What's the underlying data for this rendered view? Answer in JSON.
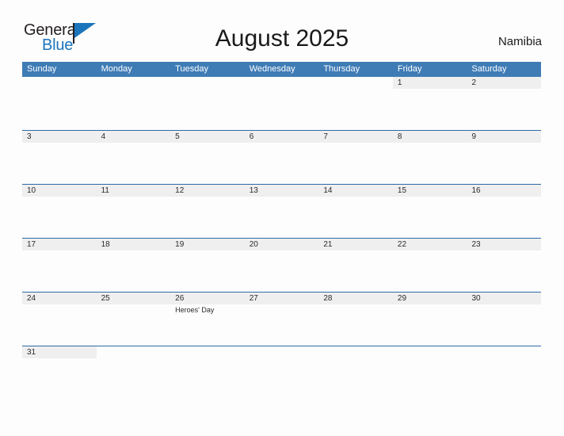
{
  "brand": {
    "name_part1": "General",
    "name_part2": "Blue",
    "flag_icon": "blue-flag-triangle"
  },
  "header": {
    "title": "August 2025",
    "country": "Namibia"
  },
  "calendar": {
    "weekday_headers": [
      "Sunday",
      "Monday",
      "Tuesday",
      "Wednesday",
      "Thursday",
      "Friday",
      "Saturday"
    ],
    "colors": {
      "header_blue": "#3f7cb6",
      "row_rule_blue": "#2c6ba5",
      "date_band_gray": "#efefef",
      "page_background": "#fdfdfd",
      "brand_blue": "#1b75bc",
      "text_dark": "#231f20"
    },
    "weeks": [
      [
        {
          "day": "",
          "event": ""
        },
        {
          "day": "",
          "event": ""
        },
        {
          "day": "",
          "event": ""
        },
        {
          "day": "",
          "event": ""
        },
        {
          "day": "",
          "event": ""
        },
        {
          "day": "1",
          "event": ""
        },
        {
          "day": "2",
          "event": ""
        }
      ],
      [
        {
          "day": "3",
          "event": ""
        },
        {
          "day": "4",
          "event": ""
        },
        {
          "day": "5",
          "event": ""
        },
        {
          "day": "6",
          "event": ""
        },
        {
          "day": "7",
          "event": ""
        },
        {
          "day": "8",
          "event": ""
        },
        {
          "day": "9",
          "event": ""
        }
      ],
      [
        {
          "day": "10",
          "event": ""
        },
        {
          "day": "11",
          "event": ""
        },
        {
          "day": "12",
          "event": ""
        },
        {
          "day": "13",
          "event": ""
        },
        {
          "day": "14",
          "event": ""
        },
        {
          "day": "15",
          "event": ""
        },
        {
          "day": "16",
          "event": ""
        }
      ],
      [
        {
          "day": "17",
          "event": ""
        },
        {
          "day": "18",
          "event": ""
        },
        {
          "day": "19",
          "event": ""
        },
        {
          "day": "20",
          "event": ""
        },
        {
          "day": "21",
          "event": ""
        },
        {
          "day": "22",
          "event": ""
        },
        {
          "day": "23",
          "event": ""
        }
      ],
      [
        {
          "day": "24",
          "event": ""
        },
        {
          "day": "25",
          "event": ""
        },
        {
          "day": "26",
          "event": "Heroes' Day"
        },
        {
          "day": "27",
          "event": ""
        },
        {
          "day": "28",
          "event": ""
        },
        {
          "day": "29",
          "event": ""
        },
        {
          "day": "30",
          "event": ""
        }
      ],
      [
        {
          "day": "31",
          "event": ""
        },
        {
          "day": "",
          "event": ""
        },
        {
          "day": "",
          "event": ""
        },
        {
          "day": "",
          "event": ""
        },
        {
          "day": "",
          "event": ""
        },
        {
          "day": "",
          "event": ""
        },
        {
          "day": "",
          "event": ""
        }
      ]
    ]
  }
}
